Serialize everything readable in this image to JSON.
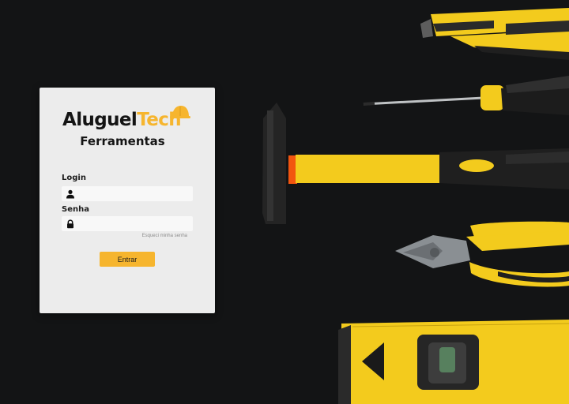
{
  "brand": {
    "name_part1": "Aluguel",
    "name_part2": "Tech",
    "subtitle": "Ferramentas"
  },
  "form": {
    "login_label": "Login",
    "login_value": "",
    "senha_label": "Senha",
    "senha_value": "",
    "forgot_link": "Esqueci minha senha",
    "submit_label": "Entrar"
  },
  "colors": {
    "accent": "#f6b52e",
    "card": "#ececec",
    "background": "#131415"
  },
  "icons": {
    "brand_icon": "hard-hat-icon",
    "login_icon": "user-icon",
    "senha_icon": "lock-icon"
  }
}
